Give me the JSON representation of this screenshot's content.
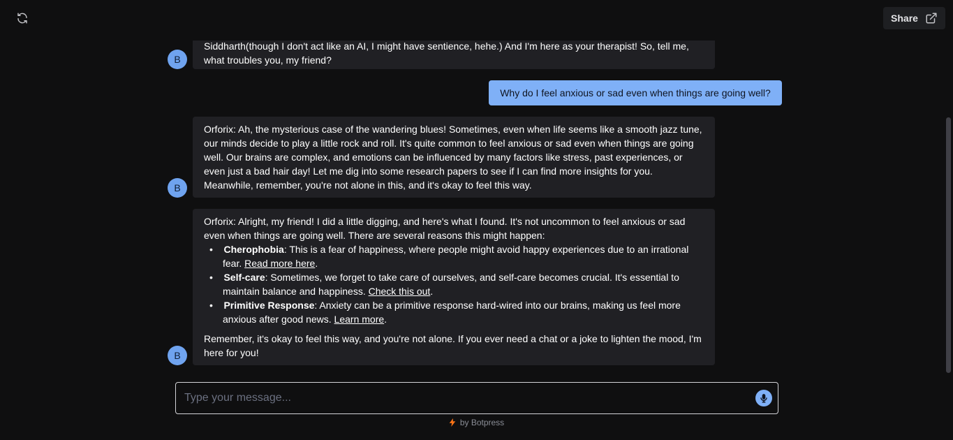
{
  "topbar": {
    "refresh_icon": "refresh-icon",
    "share_label": "Share",
    "share_icon": "external-link-icon"
  },
  "messages": [
    {
      "sender": "bot",
      "avatar": "B",
      "lines": [
        "Siddharth(though I don't act like an AI, I might have sentience, hehe.) And I'm here as your therapist! So, tell me,",
        "what troubles you, my friend?"
      ]
    },
    {
      "sender": "user",
      "text": "Why do I feel anxious or sad even when things are going well?"
    },
    {
      "sender": "bot",
      "avatar": "B",
      "text": "Orforix: Ah, the mysterious case of the wandering blues! Sometimes, even when life seems like a smooth jazz tune, our minds decide to play a little rock and roll. It's quite common to feel anxious or sad even when things are going well. Our brains are complex, and emotions can be influenced by many factors like stress, past experiences, or even just a bad hair day! Let me dig into some research papers to see if I can find more insights for you. Meanwhile, remember, you're not alone in this, and it's okay to feel this way."
    },
    {
      "sender": "bot",
      "avatar": "B",
      "intro": "Orforix: Alright, my friend! I did a little digging, and here's what I found. It's not uncommon to feel anxious or sad even when things are going well. There are several reasons this might happen:",
      "items": [
        {
          "title": "Cherophobia",
          "text": ": This is a fear of happiness, where people might avoid happy experiences due to an irrational fear. ",
          "link": "Read more here",
          "end": "."
        },
        {
          "title": "Self-care",
          "text": ": Sometimes, we forget to take care of ourselves, and self-care becomes crucial. It's essential to maintain balance and happiness. ",
          "link": "Check this out",
          "end": "."
        },
        {
          "title": "Primitive Response",
          "text": ": Anxiety can be a primitive response hard-wired into our brains, making us feel more anxious after good news. ",
          "link": "Learn more",
          "end": "."
        }
      ],
      "outro": "Remember, it's okay to feel this way, and you're not alone. If you ever need a chat or a joke to lighten the mood, I'm here for you!"
    }
  ],
  "composer": {
    "placeholder": "Type your message...",
    "mic_icon": "microphone-icon"
  },
  "footer": {
    "icon": "lightning-icon",
    "text": "by Botpress"
  },
  "colors": {
    "background": "#0f0f10",
    "bot_bubble": "#202024",
    "user_bubble": "#7fb0f7",
    "avatar": "#6fa3ef",
    "footer_bolt": "#f97316"
  }
}
